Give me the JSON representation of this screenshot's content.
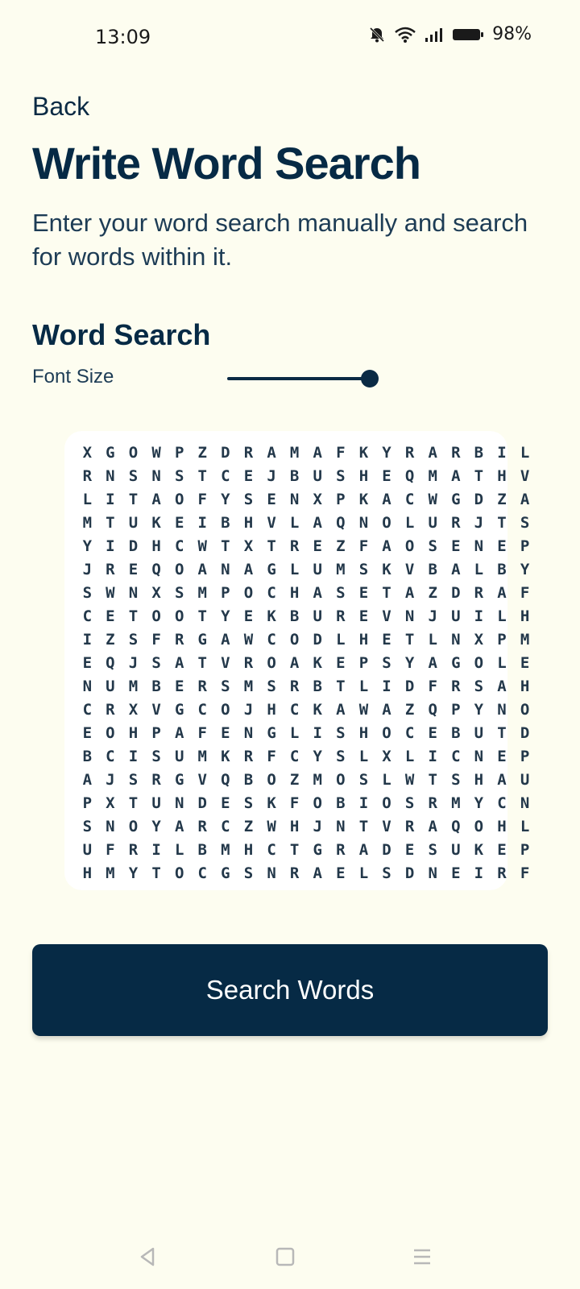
{
  "status_bar": {
    "time": "13:09",
    "battery": "98%",
    "icons": [
      "mute-bell-icon",
      "wifi-icon",
      "signal-icon",
      "battery-icon"
    ]
  },
  "header": {
    "back_label": "Back",
    "title": "Write Word Search",
    "subtitle": "Enter your word search manually and search for words within it."
  },
  "word_search": {
    "section_title": "Word Search",
    "font_size_label": "Font Size",
    "font_size_level": 1.0,
    "grid": [
      "XGOWPZDRAMAFKYRARBIL",
      "RNSNSTCEJBUSHEQMATHV",
      "LITAOFYSENXPKACWGDZA",
      "MTUKEIBHVLAQNOLURJTS",
      "YIDHCWTXTREZFAOSENEP",
      "JREQOANAGLUMSKVBALBY",
      "SWNXSMPOCHASETAZDRAF",
      "CETOOTYEKBUREVNJUILH",
      "IZSFRGAWCODLHETLNXPM",
      "EQJSATVROAKEPSYAGOLE",
      "NUMBERSMSRBTLIDFRSAH",
      "CRXVGCOJHCKAWAZQPYNO",
      "EOHPAFENGLISHOCEBUTD",
      "BCISUMKRFCYSLXLICNEP",
      "AJSRGVQBOZMOSLWTSHAU",
      "PXTUNDESKFOBIOSRMYCN",
      "SNOYARCZWHJNTVRAQOHL",
      "UFRILBMHCTGRADESUKEP",
      "HMYTOCGSNRAELSDNEIRF"
    ]
  },
  "actions": {
    "search_label": "Search Words"
  },
  "nav": {
    "icons": [
      "back-triangle-icon",
      "home-square-icon",
      "menu-lines-icon"
    ]
  },
  "colors": {
    "background": "#fdfdf0",
    "primary": "#062a45",
    "card": "#ffffff"
  }
}
